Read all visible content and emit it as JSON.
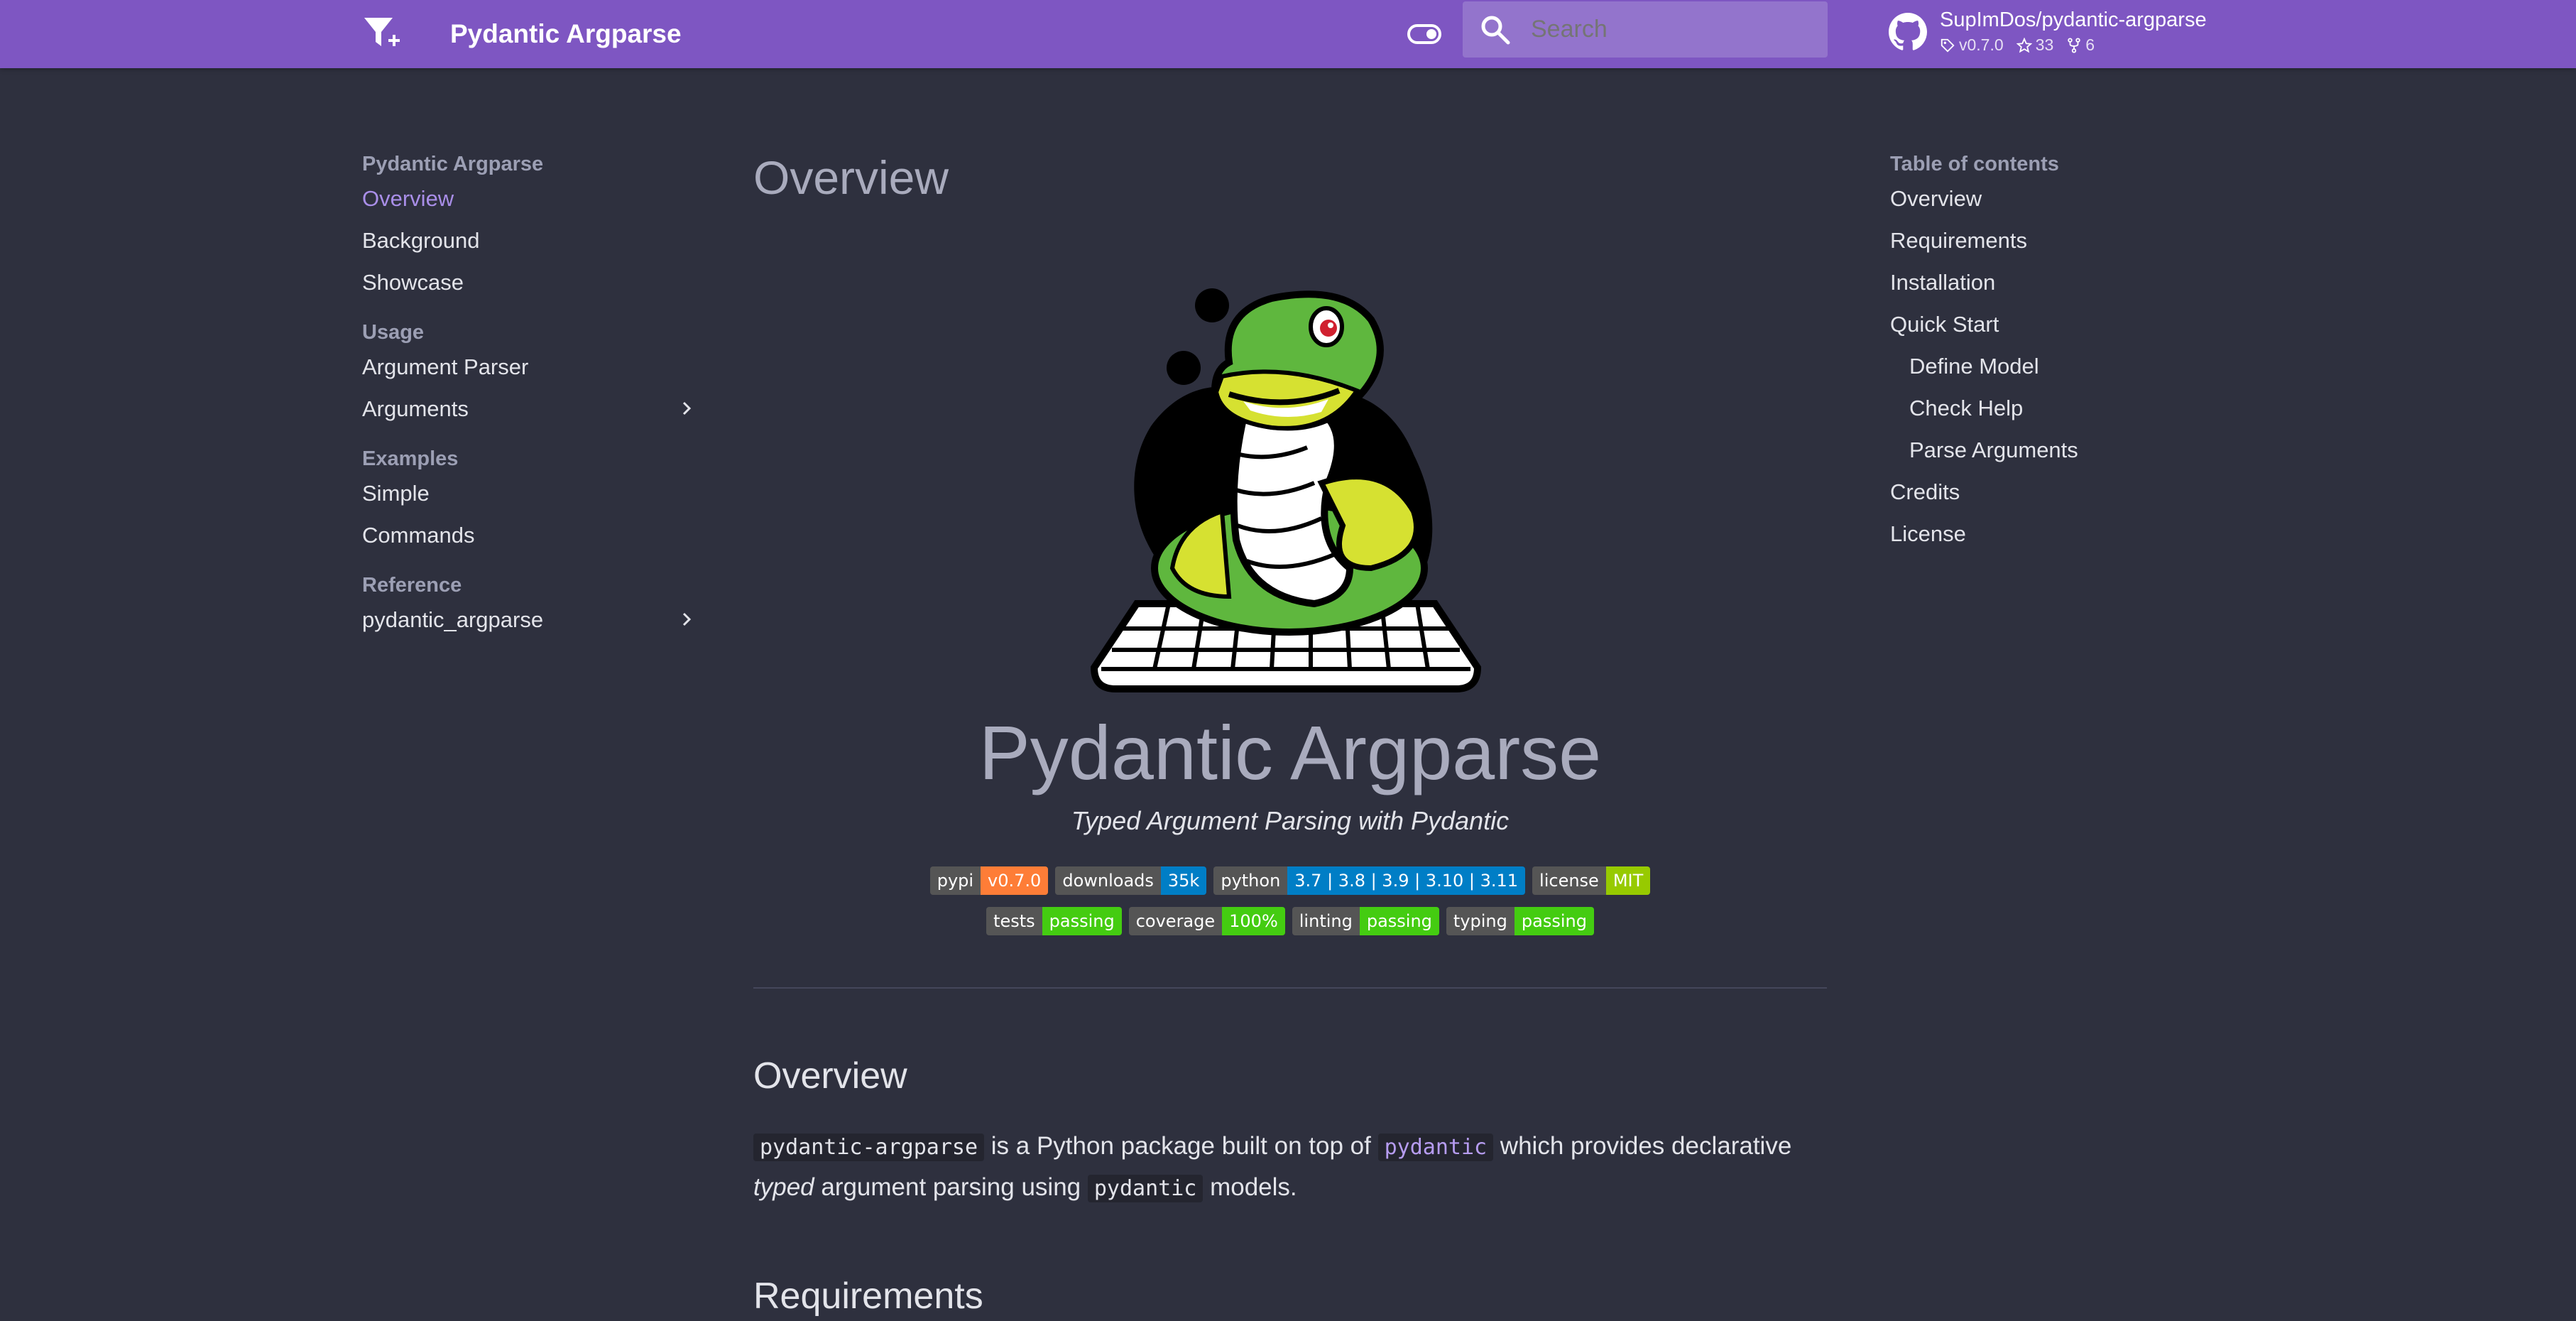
{
  "header": {
    "title": "Pydantic Argparse",
    "search_placeholder": "Search",
    "repo": {
      "name": "SupImDos/pydantic-argparse",
      "version": "v0.7.0",
      "stars": "33",
      "forks": "6"
    }
  },
  "nav": {
    "sections": [
      {
        "title": "Pydantic Argparse",
        "items": [
          "Overview",
          "Background",
          "Showcase"
        ]
      },
      {
        "title": "Usage",
        "items": [
          "Argument Parser",
          "Arguments"
        ]
      },
      {
        "title": "Examples",
        "items": [
          "Simple",
          "Commands"
        ]
      },
      {
        "title": "Reference",
        "items": [
          "pydantic_argparse"
        ]
      }
    ],
    "active": "Overview"
  },
  "toc": {
    "title": "Table of contents",
    "items": [
      "Overview",
      "Requirements",
      "Installation",
      "Quick Start",
      "Define Model",
      "Check Help",
      "Parse Arguments",
      "Credits",
      "License"
    ]
  },
  "content": {
    "h1": "Overview",
    "hero_title": "Pydantic Argparse",
    "hero_subtitle": "Typed Argument Parsing with Pydantic",
    "badges_row1": [
      {
        "label": "pypi",
        "value": "v0.7.0",
        "color": "#fe7d37"
      },
      {
        "label": "downloads",
        "value": "35k",
        "color": "#007ec6"
      },
      {
        "label": "python",
        "value": "3.7 | 3.8 | 3.9 | 3.10 | 3.11",
        "color": "#007ec6"
      },
      {
        "label": "license",
        "value": "MIT",
        "color": "#97ca00"
      }
    ],
    "badges_row2": [
      {
        "label": "tests",
        "value": "passing",
        "color": "#4c1"
      },
      {
        "label": "coverage",
        "value": "100%",
        "color": "#4c1"
      },
      {
        "label": "linting",
        "value": "passing",
        "color": "#4c1"
      },
      {
        "label": "typing",
        "value": "passing",
        "color": "#4c1"
      }
    ],
    "h2_overview": "Overview",
    "para": {
      "code1": "pydantic-argparse",
      "t1": " is a Python package built on top of ",
      "code2": "pydantic",
      "t2": " which provides declarative",
      "em": "typed",
      "t3": " argument parsing using ",
      "code3": "pydantic",
      "t4": " models."
    },
    "h2_requirements": "Requirements"
  },
  "colors": {
    "header_bg": "#7e56c2",
    "page_bg": "#2e303e",
    "accent": "#a98ee8"
  }
}
